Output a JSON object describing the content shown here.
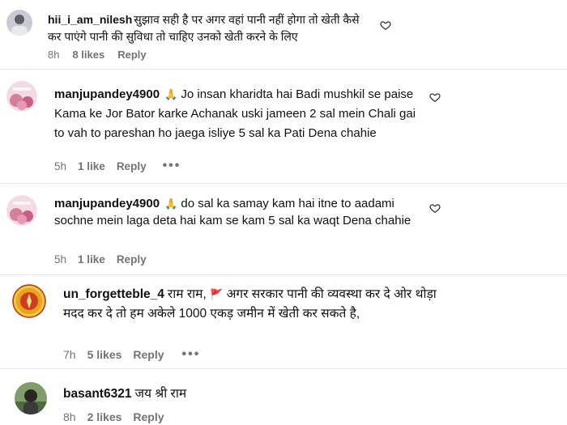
{
  "comments": [
    {
      "username": "hii_i_am_nilesh",
      "text": "सुझाव सही है पर अगर वहां पानी नहीं होगा तो खेती कैसे कर पाएंगे पानी की सुविधा तो चाहिए उनको खेती करने के लिए",
      "emoji": "",
      "time": "8h",
      "likes": "8 likes",
      "reply": "Reply",
      "more": ""
    },
    {
      "username": "manjupandey4900",
      "emoji": "🙏",
      "text": "Jo insan kharidta hai Badi mushkil se paise Kama ke Jor Bator karke Achanak uski jameen 2 sal mein Chali gai to vah to pareshan ho jaega isliye 5 sal ka Pati Dena chahie",
      "time": "5h",
      "likes": "1 like",
      "reply": "Reply",
      "more": "•••"
    },
    {
      "username": "manjupandey4900",
      "emoji": "🙏",
      "text": "do sal ka samay kam hai itne to aadami sochne mein laga deta hai kam se kam 5 sal ka waqt Dena chahie",
      "time": "5h",
      "likes": "1 like",
      "reply": "Reply",
      "more": ""
    },
    {
      "username": "un_forgetteble_4",
      "emoji": "🚩",
      "text_before": "राम राम,",
      "text": "अगर सरकार पानी की व्यवस्था कर दे ओर थोड़ा मदद कर दे तो हम अकेले 1000 एकड़ जमीन में खेती कर सकते है,",
      "time": "7h",
      "likes": "5 likes",
      "reply": "Reply",
      "more": "•••"
    },
    {
      "username": "basant6321",
      "emoji": "",
      "text": "जय श्री राम",
      "time": "8h",
      "likes": "2 likes",
      "reply": "Reply",
      "more": ""
    }
  ],
  "colors": {
    "text": "#111111",
    "meta": "#737373",
    "divider": "#e8e8e8"
  }
}
